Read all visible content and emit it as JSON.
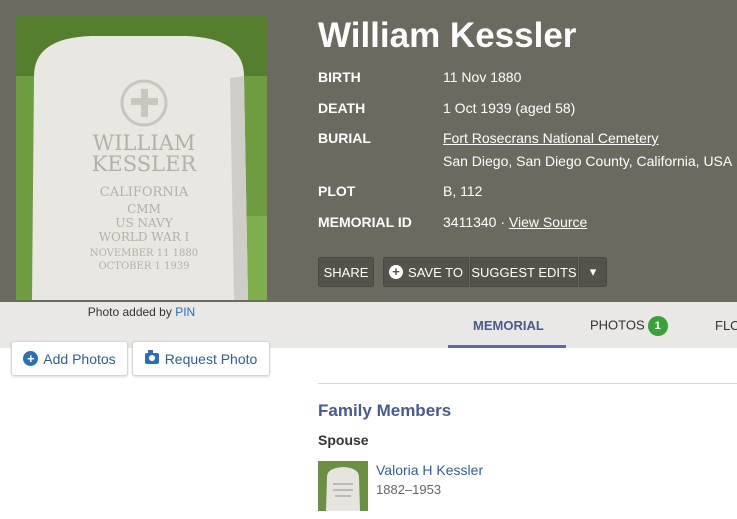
{
  "memorial": {
    "name": "William Kessler",
    "birth_label": "BIRTH",
    "birth_value": "11 Nov 1880",
    "death_label": "DEATH",
    "death_value": "1 Oct 1939 (aged 58)",
    "burial_label": "BURIAL",
    "burial_cemetery": "Fort Rosecrans National Cemetery",
    "burial_location": "San Diego, San Diego County, California, USA",
    "plot_label": "PLOT",
    "plot_value": "B, 112",
    "id_label": "MEMORIAL ID",
    "id_value": "3411340",
    "id_separator": "·",
    "view_source": "View Source"
  },
  "headstone": {
    "lines": [
      "WILLIAM",
      "KESSLER",
      "CALIFORNIA",
      "CMM",
      "US NAVY",
      "WORLD WAR I",
      "NOVEMBER 11 1880",
      "OCTOBER 1 1939"
    ]
  },
  "actions": {
    "share": "SHARE",
    "save_to": "SAVE TO",
    "suggest_edits": "SUGGEST EDITS",
    "plus_glyph": "+",
    "caret_glyph": "▾"
  },
  "photo_caption": {
    "prefix": "Photo added by",
    "user": "PIN"
  },
  "tabs": {
    "memorial": "MEMORIAL",
    "photos": "PHOTOS",
    "photos_count": "1",
    "flowers": "FLO"
  },
  "photo_buttons": {
    "add": "Add Photos",
    "request": "Request Photo"
  },
  "family": {
    "title": "Family Members",
    "spouse_heading": "Spouse",
    "spouse_name": "Valoria H Kessler",
    "spouse_dates": "1882–1953"
  },
  "colors": {
    "hero_bg": "#6c6961",
    "accent": "#4a5a8c",
    "link": "#2f5f99",
    "badge": "#39a03c"
  }
}
